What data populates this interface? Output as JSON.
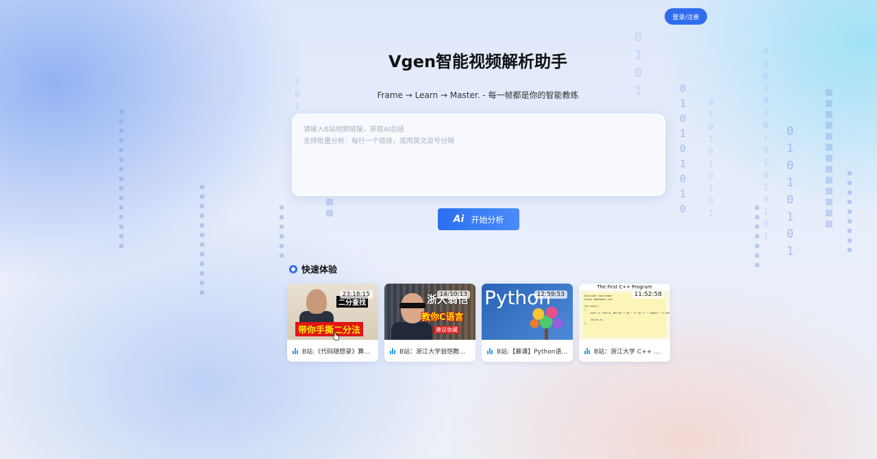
{
  "header": {
    "login_label": "登录/注册"
  },
  "hero": {
    "title": "Vgen智能视频解析助手",
    "subtitle": "Frame → Learn → Master. - 每一帧都是你的智能教练"
  },
  "input": {
    "value": "",
    "placeholder": "请输入B站视频链接，获取AI总结\n支持批量分析：每行一个链接，或用英文逗号分隔"
  },
  "analyze_button": {
    "icon": "Ai",
    "label": "开始分析"
  },
  "quick": {
    "title": "快速体验",
    "cards": [
      {
        "duration": "23:18:15",
        "title": "B站:《代码随想录》算...",
        "caption_a": "二分查找",
        "caption_b": "带你手撕二分法"
      },
      {
        "duration": "14:10:13",
        "title": "B站：浙江大学翁恺教你...",
        "caption_a": "浙大翁恺",
        "caption_b": "教你C语言",
        "caption_c": "建议收藏"
      },
      {
        "duration": "12:59:53",
        "title": "B站:【慕课】Python语...",
        "caption_a": "Python"
      },
      {
        "duration": "11:52:58",
        "title": "B站：浙江大学 C++ 翁...",
        "caption_a": "The First C++ Program",
        "code": "#include <iostream>\nusing namespace std;\n\nint main()\n{\n    cout << \"Hello, World! I am \" << 18 << \" Today!\" << endl;\n\n    return 0;\n}"
      }
    ]
  },
  "colors": {
    "accent": "#2f6cf0",
    "bili_icon": "#2f9cf0"
  },
  "icons": {
    "quick_title": "target-dot-icon",
    "card_source": "bilibili-bars-icon",
    "cursor": "hand-pointer-icon"
  }
}
